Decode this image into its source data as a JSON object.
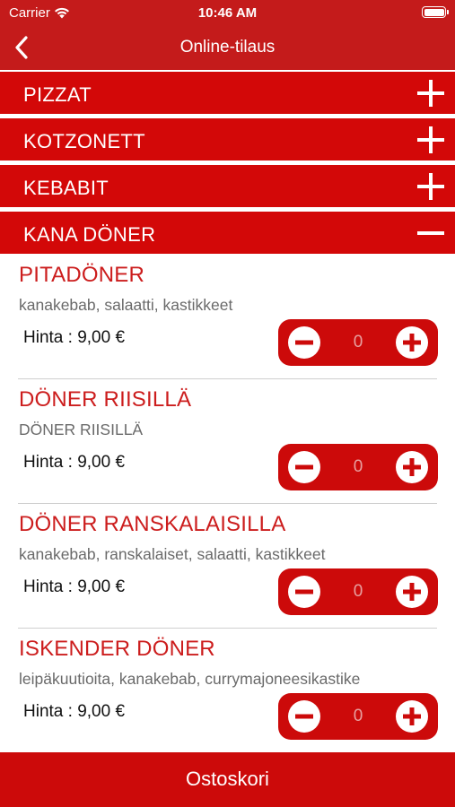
{
  "status_bar": {
    "carrier": "Carrier",
    "time": "10:46 AM"
  },
  "nav": {
    "title": "Online-tilaus"
  },
  "categories": [
    {
      "label": "PIZZAT",
      "expanded": false
    },
    {
      "label": "KOTZONETT",
      "expanded": false
    },
    {
      "label": "KEBABIT",
      "expanded": false
    },
    {
      "label": "KANA DÖNER",
      "expanded": true
    }
  ],
  "items": [
    {
      "name": "PITADÖNER",
      "description": "kanakebab, salaatti, kastikkeet",
      "price": "Hinta : 9,00 €",
      "quantity": "0"
    },
    {
      "name": "DÖNER RIISILLÄ",
      "description": "DÖNER RIISILLÄ",
      "price": "Hinta : 9,00 €",
      "quantity": "0"
    },
    {
      "name": "DÖNER RANSKALAISILLA",
      "description": "kanakebab, ranskalaiset, salaatti, kastikkeet",
      "price": "Hinta : 9,00 €",
      "quantity": "0"
    },
    {
      "name": "ISKENDER DÖNER",
      "description": "leipäkuutioita, kanakebab, currymajoneesikastike",
      "price": "Hinta : 9,00 €",
      "quantity": "0"
    }
  ],
  "cart": {
    "label": "Ostoskori"
  },
  "colors": {
    "brand_red": "#c41b1b",
    "category_red": "#d30808",
    "stepper_red": "#cc0a0a",
    "item_title_red": "#cc1d1d"
  }
}
